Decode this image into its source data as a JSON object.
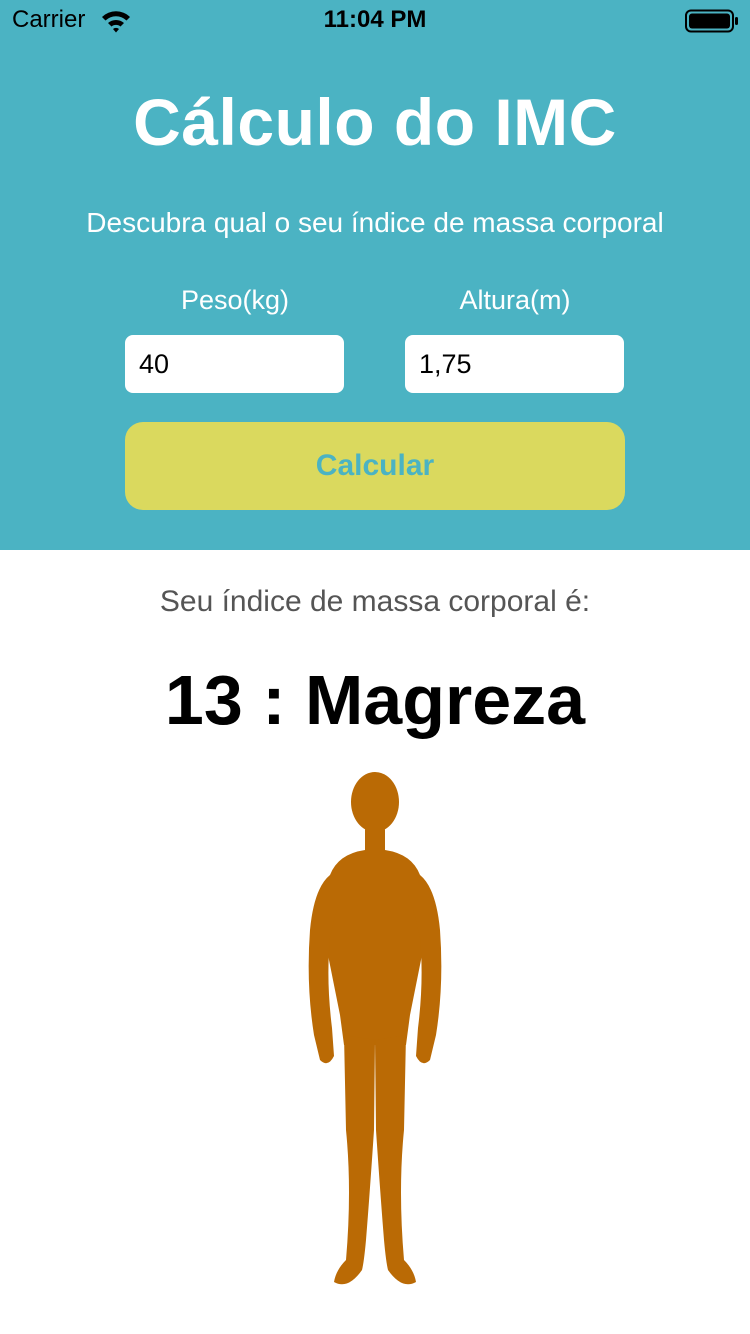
{
  "status_bar": {
    "carrier": "Carrier",
    "time": "11:04 PM",
    "wifi_icon": "wifi-icon",
    "battery_icon": "battery-icon"
  },
  "header": {
    "title": "Cálculo do IMC",
    "subtitle": "Descubra qual o seu índice de massa corporal",
    "background_color": "#4BB3C3"
  },
  "form": {
    "weight_label": "Peso(kg)",
    "weight_value": "40",
    "height_label": "Altura(m)",
    "height_value": "1,75",
    "calculate_button": "Calcular",
    "button_color": "#DAD95E"
  },
  "result": {
    "label": "Seu índice de massa corporal é:",
    "value": "13 : Magreza",
    "figure_icon": "body-silhouette-icon",
    "figure_color": "#BA6A05"
  }
}
